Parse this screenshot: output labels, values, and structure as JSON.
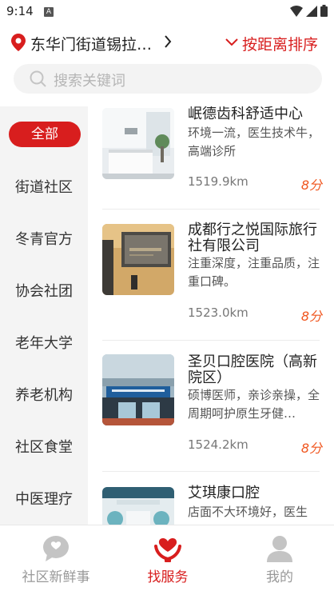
{
  "status_bar": {
    "time": "9:14",
    "notification_letter": "A"
  },
  "header": {
    "location": "东华门街道锡拉…",
    "sort_label": "按距离排序"
  },
  "search": {
    "placeholder": "搜索关键词"
  },
  "sidebar": {
    "items": [
      "全部",
      "街道社区",
      "冬青官方",
      "协会社团",
      "老年大学",
      "养老机构",
      "社区食堂",
      "中医理疗"
    ],
    "active_index": 0
  },
  "services": [
    {
      "title": "岷德齿科舒适中心",
      "desc": "环境一流，医生技术牛，高端诊所",
      "distance": "1519.9km",
      "score": "8分"
    },
    {
      "title": "成都行之悦国际旅行社有限公司",
      "desc": "注重深度，注重品质，注重口碑。",
      "distance": "1523.0km",
      "score": "8分"
    },
    {
      "title": "圣贝口腔医院（高新院区）",
      "desc": "硕博医师，亲诊亲操，全周期呵护原生牙健…",
      "distance": "1524.2km",
      "score": "8分"
    },
    {
      "title": "艾琪康口腔",
      "desc": "店面不大环境好，医生",
      "distance": "",
      "score": ""
    }
  ],
  "tabbar": {
    "tabs": [
      {
        "label": "社区新鲜事",
        "icon": "chat-bubble-icon"
      },
      {
        "label": "找服务",
        "icon": "heart-hands-icon"
      },
      {
        "label": "我的",
        "icon": "person-icon"
      }
    ],
    "active_index": 1
  },
  "colors": {
    "accent": "#d81e1e",
    "score": "#f0561f",
    "sidebar_bg": "#f4f4f4"
  }
}
